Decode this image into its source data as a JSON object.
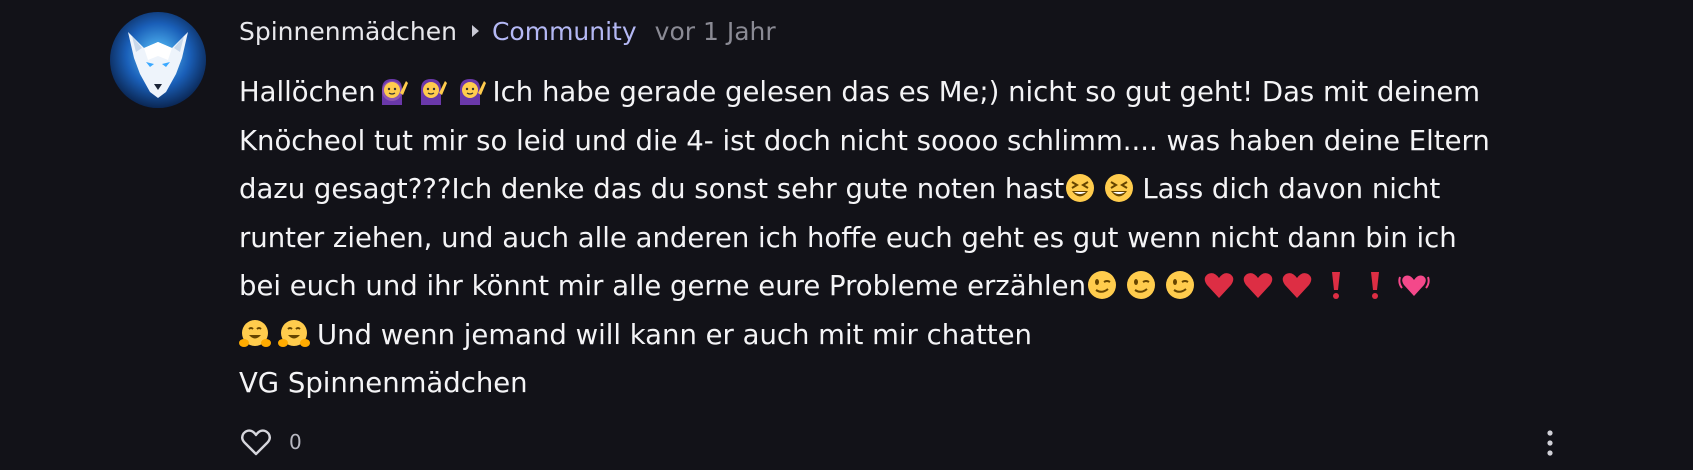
{
  "post": {
    "author": "Spinnenmädchen",
    "community": "Community",
    "time": "vor 1 Jahr",
    "avatar_icon": "white-wolf-avatar",
    "like_icon": "heart-outline-icon",
    "like_count": "0",
    "more_icon": "vertical-ellipsis-icon",
    "body": {
      "line1_a": "Hallöchen",
      "line1_b": "Ich habe gerade gelesen das es Me;) nicht so gut geht! Das mit deinem",
      "line2": "Knöcheol tut mir so leid und die 4- ist doch nicht soooo schlimm.... was haben deine Eltern",
      "line3_a": "dazu gesagt???Ich denke das du sonst sehr gute noten hast",
      "line3_b": "Lass dich davon nicht",
      "line4": "runter ziehen, und auch alle anderen ich hoffe euch geht es gut wenn nicht dann bin ich",
      "line5": "bei euch und ihr könnt mir alle gerne eure Probleme erzählen",
      "line6": "Und wenn jemand will kann er auch mit mir chatten",
      "line7": "VG Spinnenmädchen"
    },
    "emoji_groups": {
      "line1": [
        "person-raising-hand-emoji",
        "person-raising-hand-emoji",
        "person-raising-hand-emoji"
      ],
      "line3": [
        "grinning-squinting-face-emoji",
        "grinning-squinting-face-emoji"
      ],
      "line5": [
        "winking-face-emoji",
        "winking-face-emoji",
        "winking-face-emoji",
        "red-heart-emoji",
        "red-heart-emoji",
        "red-heart-emoji",
        "exclamation-mark-emoji",
        "exclamation-mark-emoji",
        "beating-heart-emoji"
      ],
      "line6": [
        "hugging-face-emoji",
        "hugging-face-emoji"
      ]
    }
  },
  "colors": {
    "background": "#121218",
    "text": "#f4f4f6",
    "community_accent": "#b4b8f4",
    "muted": "#8a8a94"
  }
}
